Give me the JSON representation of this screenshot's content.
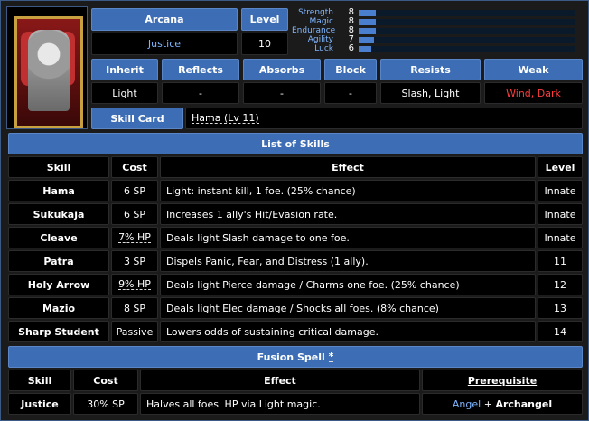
{
  "header": {
    "arcana_label": "Arcana",
    "arcana_value": "Justice",
    "level_label": "Level",
    "level_value": "10"
  },
  "stats": [
    {
      "name": "Strength",
      "value": 8,
      "fraction": 0.08
    },
    {
      "name": "Magic",
      "value": 8,
      "fraction": 0.08
    },
    {
      "name": "Endurance",
      "value": 8,
      "fraction": 0.08
    },
    {
      "name": "Agility",
      "value": 7,
      "fraction": 0.07
    },
    {
      "name": "Luck",
      "value": 6,
      "fraction": 0.06
    }
  ],
  "resist_table": {
    "headers": [
      "Inherit",
      "Reflects",
      "Absorbs",
      "Block",
      "Resists",
      "Weak"
    ],
    "values": [
      "Light",
      "-",
      "-",
      "-",
      "Slash, Light",
      "Wind, Dark"
    ]
  },
  "skill_card": {
    "label": "Skill Card",
    "value": "Hama (Lv 11)"
  },
  "skills": {
    "title": "List of Skills",
    "headers": {
      "skill": "Skill",
      "cost": "Cost",
      "effect": "Effect",
      "level": "Level"
    },
    "rows": [
      {
        "skill": "Hama",
        "cost": "6 SP",
        "effect": "Light: instant kill, 1 foe. (25% chance)",
        "level": "Innate"
      },
      {
        "skill": "Sukukaja",
        "cost": "6 SP",
        "effect": "Increases 1 ally's Hit/Evasion rate.",
        "level": "Innate"
      },
      {
        "skill": "Cleave",
        "cost": "7% HP",
        "effect": "Deals light Slash damage to one foe.",
        "level": "Innate"
      },
      {
        "skill": "Patra",
        "cost": "3 SP",
        "effect": "Dispels Panic, Fear, and Distress (1 ally).",
        "level": "11"
      },
      {
        "skill": "Holy Arrow",
        "cost": "9% HP",
        "effect": "Deals light Pierce damage / Charms one foe. (25% chance)",
        "level": "12"
      },
      {
        "skill": "Mazio",
        "cost": "8 SP",
        "effect": "Deals light Elec damage / Shocks all foes. (8% chance)",
        "level": "13"
      },
      {
        "skill": "Sharp Student",
        "cost": "Passive",
        "effect": "Lowers odds of sustaining critical damage.",
        "level": "14"
      }
    ]
  },
  "fusion": {
    "title": "Fusion Spell",
    "title_mark": "*",
    "headers": {
      "skill": "Skill",
      "cost": "Cost",
      "effect": "Effect",
      "prereq": "Prerequisite"
    },
    "row": {
      "skill": "Justice",
      "cost": "30% SP",
      "effect": "Halves all foes' HP via Light magic.",
      "prereq_a": "Angel",
      "prereq_sep": "+",
      "prereq_b": "Archangel"
    }
  },
  "colors": {
    "accent": "#3d6eb5",
    "weak": "#ff3b3b",
    "value_blue": "#7fb6ff"
  }
}
